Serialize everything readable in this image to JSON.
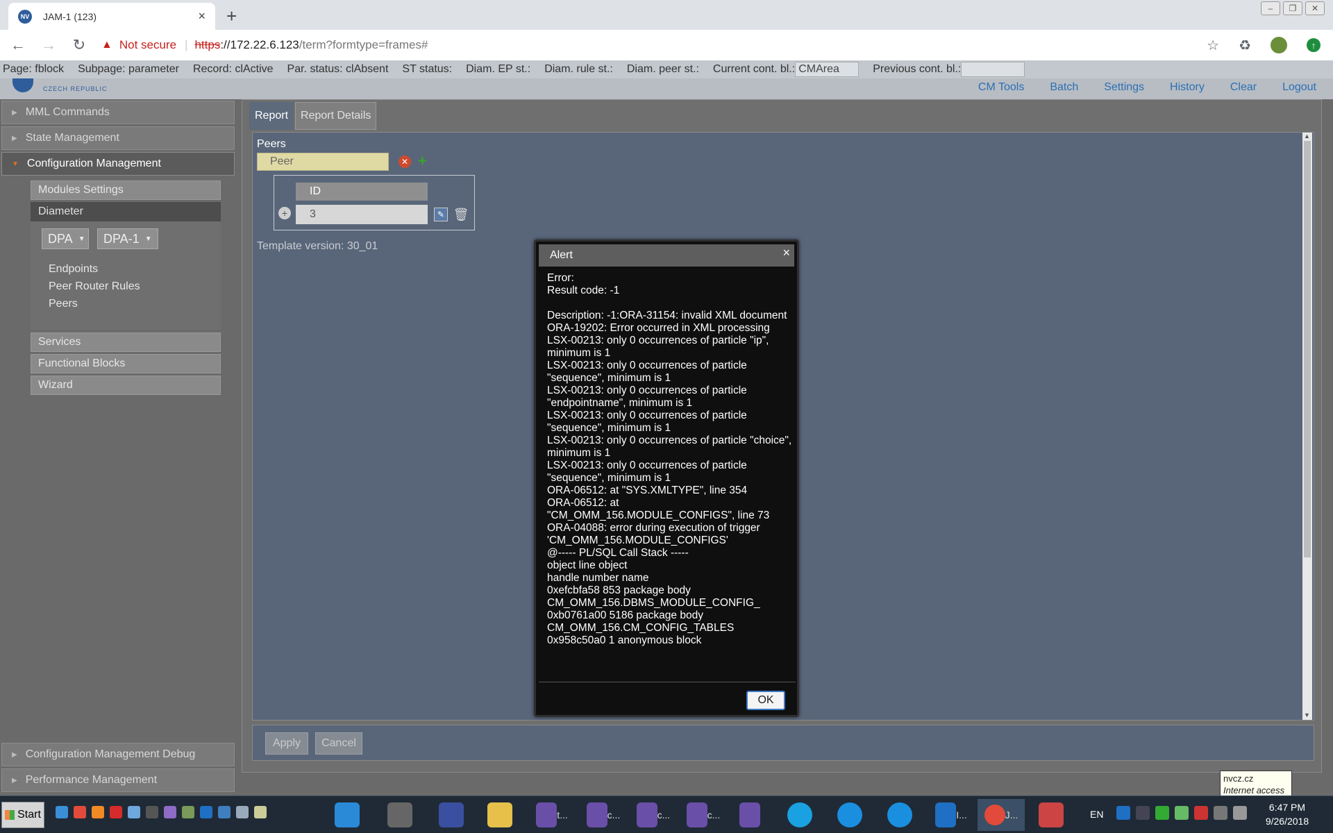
{
  "browser": {
    "tab_title": "JAM-1 (123)",
    "tab_close": "×",
    "new_tab": "+",
    "security_label": "Not secure",
    "url_scheme": "https",
    "url_rest_host": "://172.22.6.123",
    "url_path": "/term?formtype=frames#"
  },
  "status": {
    "page": "Page: fblock",
    "subpage": "Subpage: parameter",
    "record": "Record: clActive",
    "par_status": "Par. status: clAbsent",
    "st_status": "ST status:",
    "diam_ep": "Diam. EP st.:",
    "diam_rule": "Diam. rule st.:",
    "diam_peer": "Diam. peer st.:",
    "current_label": "Current cont. bl.:",
    "current_value": "CMArea",
    "previous_label": "Previous cont. bl.:",
    "previous_value": ""
  },
  "logo": {
    "subtitle": "CZECH REPUBLIC"
  },
  "topnav": [
    "CM Tools",
    "Batch",
    "Settings",
    "History",
    "Clear",
    "Logout"
  ],
  "sidebar": {
    "sections": {
      "mml": "MML Commands",
      "state": "State Management",
      "config": "Configuration Management",
      "config_debug": "Configuration Management Debug",
      "perf": "Performance Management"
    },
    "sub": {
      "modules": "Modules Settings",
      "diameter": "Diameter",
      "services": "Services",
      "functional": "Functional Blocks",
      "wizard": "Wizard"
    },
    "selects": {
      "left": "DPA",
      "right": "DPA-1"
    },
    "links": [
      "Endpoints",
      "Peer Router Rules",
      "Peers"
    ]
  },
  "main": {
    "tabs": [
      "Report",
      "Report Details"
    ],
    "peers_label": "Peers",
    "peer_field": "Peer",
    "id_header": "ID",
    "id_value": "3",
    "template_version": "Template version: 30_01",
    "apply": "Apply",
    "cancel": "Cancel"
  },
  "alert": {
    "title": "Alert",
    "close": "×",
    "message": "Error:\nResult code: -1\n\nDescription: -1:ORA-31154: invalid XML document\nORA-19202: Error occurred in XML processing\nLSX-00213: only 0 occurrences of particle \"ip\", minimum is 1\nLSX-00213: only 0 occurrences of particle \"sequence\", minimum is 1\nLSX-00213: only 0 occurrences of particle \"endpointname\", minimum is 1\nLSX-00213: only 0 occurrences of particle \"sequence\", minimum is 1\nLSX-00213: only 0 occurrences of particle \"choice\", minimum is 1\nLSX-00213: only 0 occurrences of particle \"sequence\", minimum is 1\nORA-06512: at \"SYS.XMLTYPE\", line 354\nORA-06512: at\n\"CM_OMM_156.MODULE_CONFIGS\", line 73\nORA-04088: error during execution of trigger 'CM_OMM_156.MODULE_CONFIGS'\n@----- PL/SQL Call Stack -----\nobject line object\nhandle number name\n0xefcbfa58 853 package body\nCM_OMM_156.DBMS_MODULE_CONFIG_\n0xb0761a00 5186 package body\nCM_OMM_156.CM_CONFIG_TABLES\n0x958c50a0 1 anonymous block",
    "ok": "OK"
  },
  "taskbar": {
    "start": "Start",
    "apps": [
      "t...",
      "c...",
      "c...",
      "c...",
      "J...",
      "I..."
    ],
    "lang": "EN",
    "time": "6:47 PM",
    "date": "9/26/2018"
  },
  "tooltip": {
    "line1": "nvcz.cz",
    "line2": "Internet access"
  },
  "colors": {
    "accent_link": "#2a6fb6",
    "content_bg": "#59667a",
    "modal_bg": "#0f0f0f",
    "warning": "#c5221f"
  }
}
